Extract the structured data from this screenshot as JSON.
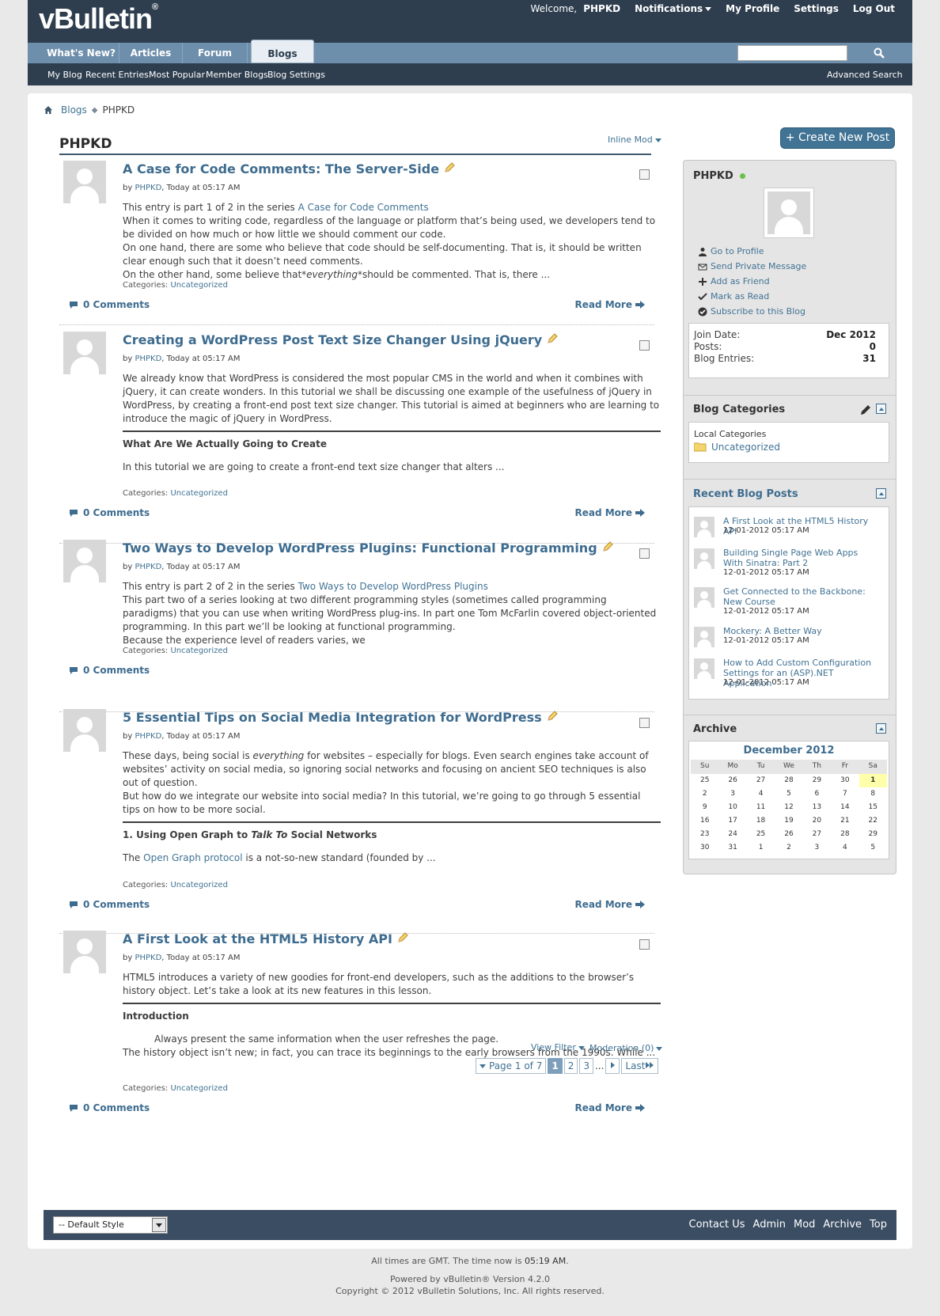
{
  "header": {
    "logo_text": "vBulletin",
    "logo_mark": "®",
    "welcome": "Welcome,",
    "username": "PHPKD",
    "notifications": "Notifications",
    "my_profile": "My Profile",
    "settings": "Settings",
    "logout": "Log Out"
  },
  "tabs": [
    "What's New?",
    "Articles",
    "Forum",
    "Blogs"
  ],
  "subnav": [
    "My Blog",
    "Recent Entries",
    "Most Popular",
    "Member Blogs",
    "Blog Settings"
  ],
  "advanced_search": "Advanced Search",
  "breadcrumb": {
    "root": "Blogs",
    "current": "PHPKD"
  },
  "blog_title": "PHPKD",
  "inline_mod": "Inline Mod",
  "create_post": "+ Create New Post",
  "posts": [
    {
      "title": "A Case for Code Comments: The Server-Side",
      "by_prefix": "by",
      "author": "PHPKD",
      "date": ", Today at 05:17 AM",
      "series_prefix": "This entry is part 1 of 2 in the series",
      "series_link": "A Case for Code Comments",
      "paragraphs": [
        "When it comes to writing code, regardless of the language or platform that’s being used, we developers tend to be divided on how much or how little we should comment our code.",
        "On one hand, there are some who believe that code should be self-documenting. That is, it should be written clear enough such that it doesn’t need comments."
      ],
      "last_pre": "On the other hand, some believe that*",
      "last_em": "everything",
      "last_post": "*should be commented. That is, there ...",
      "categories_label": "Categories:",
      "category": "Uncategorized",
      "comments": "0 Comments",
      "read_more": "Read More"
    },
    {
      "title": "Creating a WordPress Post Text Size Changer Using jQuery",
      "author": "PHPKD",
      "date": ", Today at 05:17 AM",
      "paragraph": "We already know that WordPress is considered the most popular CMS in the world and when it combines with jQuery, it can create wonders. In this tutorial we shall be discussing one example of the usefulness of jQuery in WordPress, by creating a front-end post text size changer. This tutorial is aimed at beginners who are learning to introduce the magic of jQuery in WordPress.",
      "heading": "What Are We Actually Going to Create",
      "after": "In this tutorial we are going to create a front-end text size changer that alters ...",
      "category": "Uncategorized",
      "comments": "0 Comments",
      "read_more": "Read More"
    },
    {
      "title": "Two Ways to Develop WordPress Plugins: Functional Programming",
      "author": "PHPKD",
      "date": ", Today at 05:17 AM",
      "series_prefix": "This entry is part 2 of 2 in the series",
      "series_link": "Two Ways to Develop WordPress Plugins",
      "paragraphs": [
        "This part two of a series looking at two different programming styles (sometimes called programming paradigms) that you can use when writing WordPress plug-ins. In part one Tom McFarlin covered object-oriented programming. In this part we’ll be looking at functional programming.",
        "Because the experience level of readers varies, we"
      ],
      "category": "Uncategorized",
      "comments": "0 Comments"
    },
    {
      "title": "5 Essential Tips on Social Media Integration for WordPress",
      "author": "PHPKD",
      "date": ", Today at 05:17 AM",
      "p1_pre": "These days, being social is ",
      "p1_em": "everything",
      "p1_post": " for websites – especially for blogs. Even search engines take account of websites’ activity on social media, so ignoring social networks and focusing on ancient SEO techniques is also out of question.",
      "p2": "But how do we integrate our website into social media? In this tutorial, we’re going to go through 5 essential tips on how to be more social.",
      "heading_pre": "1. Using Open Graph to ",
      "heading_em": "Talk To",
      "heading_post": " Social Networks",
      "after_pre": "The ",
      "after_link": "Open Graph protocol",
      "after_post": " is a not-so-new standard (founded by ...",
      "category": "Uncategorized",
      "comments": "0 Comments",
      "read_more": "Read More"
    },
    {
      "title": "A First Look at the HTML5 History API",
      "author": "PHPKD",
      "date": ", Today at 05:17 AM",
      "paragraph": "HTML5 introduces a variety of new goodies for front-end developers, such as the additions to the browser’s history object. Let’s take a look at its new features in this lesson.",
      "heading": "Introduction",
      "indent": "Always present the same information when the user refreshes the page.",
      "after": "The history object isn’t new; in fact, you can trace its beginnings to the early browsers from the 1990s. While ...",
      "category": "Uncategorized",
      "comments": "0 Comments",
      "read_more": "Read More"
    }
  ],
  "sidebar": {
    "username": "PHPKD",
    "links": [
      "Go to Profile",
      "Send Private Message",
      "Add as Friend",
      "Mark as Read",
      "Subscribe to this Blog"
    ],
    "stats": [
      {
        "label": "Join Date:",
        "value": "Dec 2012"
      },
      {
        "label": "Posts:",
        "value": "0"
      },
      {
        "label": "Blog Entries:",
        "value": "31"
      }
    ],
    "categories_title": "Blog Categories",
    "local_categories": "Local Categories",
    "category": "Uncategorized",
    "recent_title": "Recent Blog Posts",
    "recent": [
      {
        "title": "A First Look at the HTML5 History API",
        "date": "12-01-2012 05:17 AM"
      },
      {
        "title": "Building Single Page Web Apps With Sinatra: Part 2",
        "date": "12-01-2012 05:17 AM"
      },
      {
        "title": "Get Connected to the Backbone: New Course",
        "date": "12-01-2012 05:17 AM"
      },
      {
        "title": "Mockery: A Better Way",
        "date": "12-01-2012 05:17 AM"
      },
      {
        "title": "How to Add Custom Configuration Settings for an (ASP).NET Application",
        "date": "12-01-2012 05:17 AM"
      }
    ],
    "archive_title": "Archive",
    "calendar": {
      "month": "December 2012",
      "days": [
        "Su",
        "Mo",
        "Tu",
        "We",
        "Th",
        "Fr",
        "Sa"
      ],
      "weeks": [
        [
          "25",
          "26",
          "27",
          "28",
          "29",
          "30",
          "1"
        ],
        [
          "2",
          "3",
          "4",
          "5",
          "6",
          "7",
          "8"
        ],
        [
          "9",
          "10",
          "11",
          "12",
          "13",
          "14",
          "15"
        ],
        [
          "16",
          "17",
          "18",
          "19",
          "20",
          "21",
          "22"
        ],
        [
          "23",
          "24",
          "25",
          "26",
          "27",
          "28",
          "29"
        ],
        [
          "30",
          "31",
          "1",
          "2",
          "3",
          "4",
          "5"
        ]
      ],
      "today": "1"
    }
  },
  "pager": {
    "view_filter": "View Filter",
    "moderation": "Moderation (0)",
    "page_of": "Page 1 of 7",
    "pages": [
      "1",
      "2",
      "3"
    ],
    "ellipsis": "...",
    "last": "Last"
  },
  "footer": {
    "style": "-- Default Style",
    "links": [
      "Contact Us",
      "Admin",
      "Mod",
      "Archive",
      "Top"
    ],
    "time_pre": "All times are GMT. The time now is ",
    "time": "05:19 AM",
    "time_post": ".",
    "powered": "Powered by vBulletin® Version 4.2.0",
    "copyright": "Copyright © 2012 vBulletin Solutions, Inc. All rights reserved."
  },
  "colors": {
    "nav": "#2e3e4f",
    "tab_bar": "#6e8fac",
    "link": "#417394",
    "title": "#3e6c8f"
  }
}
